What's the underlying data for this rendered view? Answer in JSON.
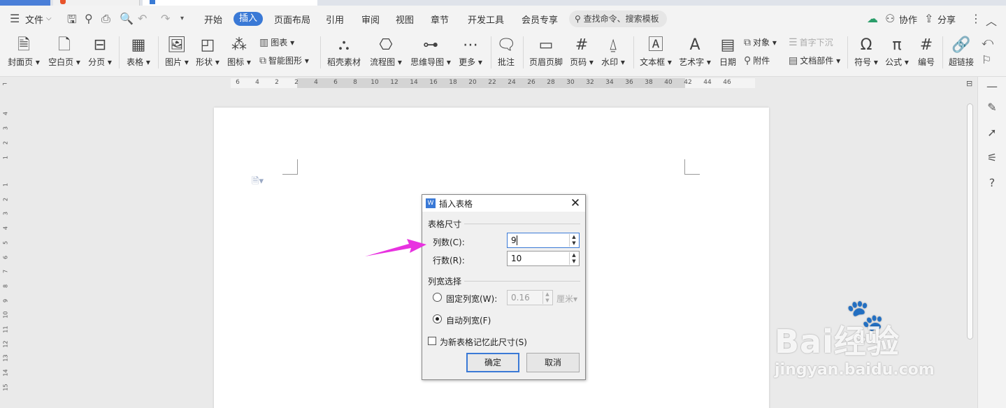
{
  "menubar": {
    "file": "文件",
    "tabs": [
      "开始",
      "插入",
      "页面布局",
      "引用",
      "审阅",
      "视图",
      "章节",
      "开发工具",
      "会员专享"
    ],
    "active_tab": "插入",
    "search_placeholder": "查找命令、搜索模板",
    "collab": "协作",
    "share": "分享"
  },
  "ribbon": {
    "cover": "封面页",
    "blank": "空白页",
    "pagebreak": "分页",
    "table": "表格",
    "picture": "图片",
    "shape": "形状",
    "icon": "图标",
    "chart": "图表",
    "smartart": "智能图形",
    "material": "稻壳素材",
    "flowchart": "流程图",
    "mindmap": "思维导图",
    "more": "更多",
    "comment": "批注",
    "header_footer": "页眉页脚",
    "page_number": "页码",
    "watermark": "水印",
    "textbox": "文本框",
    "wordart": "艺术字",
    "date": "日期",
    "object": "对象",
    "attachment": "附件",
    "dropcap": "首字下沉",
    "doc_parts": "文档部件",
    "symbol": "符号",
    "formula": "公式",
    "numbering": "编号",
    "hyperlink": "超链接"
  },
  "ruler": {
    "h_ticks": [
      "6",
      "4",
      "2",
      "2",
      "4",
      "6",
      "8",
      "10",
      "12",
      "14",
      "16",
      "18",
      "20",
      "22",
      "24",
      "26",
      "28",
      "30",
      "32",
      "34",
      "36",
      "38",
      "40",
      "42",
      "44",
      "46"
    ],
    "v_ticks": [
      "4",
      "3",
      "2",
      "1",
      "1",
      "2",
      "3",
      "4",
      "5",
      "6",
      "7",
      "8",
      "9",
      "10",
      "11",
      "12",
      "13",
      "14",
      "15"
    ]
  },
  "dialog": {
    "title": "插入表格",
    "size_group": "表格尺寸",
    "cols_label": "列数(C):",
    "cols_value": "9",
    "rows_label": "行数(R):",
    "rows_value": "10",
    "width_group": "列宽选择",
    "fixed_label": "固定列宽(W):",
    "fixed_value": "0.16",
    "unit": "厘米",
    "auto_label": "自动列宽(F)",
    "selected_mode": "auto",
    "remember_label": "为新表格记忆此尺寸(S)",
    "remember_checked": false,
    "ok": "确定",
    "cancel": "取消"
  },
  "watermark": {
    "brand": "Bai经验",
    "paw_text": "du",
    "site": "jingyan.baidu.com"
  },
  "colors": {
    "accent": "#3a79d6",
    "arrow": "#e832e0"
  }
}
